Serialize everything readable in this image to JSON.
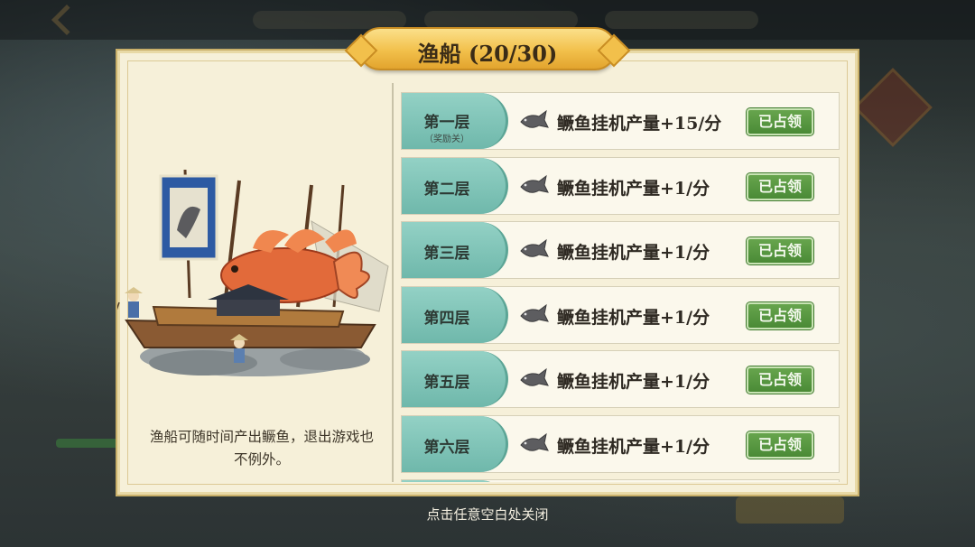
{
  "title": "渔船 (20/30)",
  "description": "渔船可随时间产出鳜鱼，退出游戏也不例外。",
  "close_hint": "点击任意空白处关闭",
  "colors": {
    "tag_teal": "#6fb8ab",
    "claimed_green": "#4a8a36",
    "panel_cream": "#f6f0d9",
    "title_gold": "#f2c04b"
  },
  "floors": [
    {
      "name": "第一层",
      "sub": "（奖励关）",
      "reward": "鳜鱼挂机产量+15/分",
      "status": "已占领",
      "icon": "fish-icon"
    },
    {
      "name": "第二层",
      "sub": "",
      "reward": "鳜鱼挂机产量+1/分",
      "status": "已占领",
      "icon": "fish-icon"
    },
    {
      "name": "第三层",
      "sub": "",
      "reward": "鳜鱼挂机产量+1/分",
      "status": "已占领",
      "icon": "fish-icon"
    },
    {
      "name": "第四层",
      "sub": "",
      "reward": "鳜鱼挂机产量+1/分",
      "status": "已占领",
      "icon": "fish-icon"
    },
    {
      "name": "第五层",
      "sub": "",
      "reward": "鳜鱼挂机产量+1/分",
      "status": "已占领",
      "icon": "fish-icon"
    },
    {
      "name": "第六层",
      "sub": "",
      "reward": "鳜鱼挂机产量+1/分",
      "status": "已占领",
      "icon": "fish-icon"
    }
  ]
}
